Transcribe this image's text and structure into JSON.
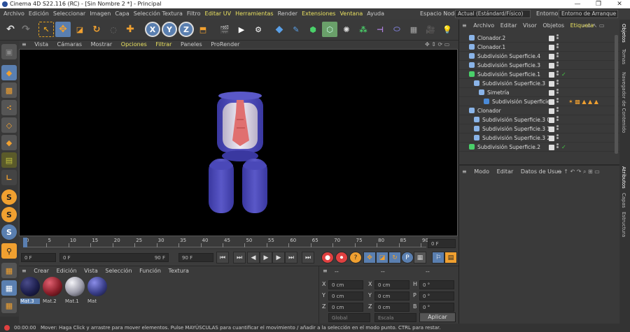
{
  "window": {
    "title": "Cinema 4D S22.116 (RC) - [Sin Nombre 2 *] - Principal",
    "minimize": "—",
    "restore": "❐",
    "close": "✕"
  },
  "menubar": {
    "items": [
      "Archivo",
      "Edición",
      "Seleccionar",
      "Imagen",
      "Capa",
      "Selección Textura",
      "Filtro",
      "Editar UV",
      "Herramientas",
      "Render",
      "Extensiones",
      "Ventana",
      "Ayuda"
    ],
    "node_space_label": "Espacio Nodo:",
    "node_space_value": "Actual (Estándard/Físico)",
    "layout_label": "Entorno:",
    "layout_value": "Entorno de Arranque"
  },
  "toolbar": {
    "x": "X",
    "y": "Y",
    "z": "Z"
  },
  "viewport": {
    "menu": [
      "Vista",
      "Cámaras",
      "Mostrar",
      "Opciones",
      "Filtrar",
      "Paneles",
      "ProRender"
    ]
  },
  "timeline": {
    "ticks": [
      "0",
      "5",
      "10",
      "15",
      "20",
      "25",
      "30",
      "35",
      "40",
      "45",
      "50",
      "55",
      "60",
      "65",
      "70",
      "75",
      "80",
      "85",
      "90"
    ],
    "current_frame": "0 F"
  },
  "transport": {
    "start": "0 F",
    "range_start": "0 F",
    "range_end": "90 F",
    "end": "90 F"
  },
  "materials": {
    "menu": [
      "Crear",
      "Edición",
      "Vista",
      "Selección",
      "Función",
      "Textura"
    ],
    "items": [
      {
        "name": "Mat.3",
        "color": "#1d1f4d"
      },
      {
        "name": "Mat.2",
        "color": "#8a1f2a"
      },
      {
        "name": "Mat.1",
        "color": "#9a9aa8"
      },
      {
        "name": "Mat",
        "color": "#3a3f8a"
      }
    ]
  },
  "coordinates": {
    "header_left": "--",
    "header_mid": "--",
    "header_right": "--",
    "rows": [
      {
        "a": "X",
        "av": "0 cm",
        "b": "X",
        "bv": "0 cm",
        "c": "H",
        "cv": "0 °"
      },
      {
        "a": "Y",
        "av": "0 cm",
        "b": "Y",
        "bv": "0 cm",
        "c": "P",
        "cv": "0 °"
      },
      {
        "a": "Z",
        "av": "0 cm",
        "b": "Z",
        "bv": "0 cm",
        "c": "B",
        "cv": "0 °"
      }
    ],
    "mode1": "Global",
    "mode2": "Escala",
    "apply": "Aplicar"
  },
  "objects": {
    "menu": [
      "Archivo",
      "Editar",
      "Visor",
      "Objetos",
      "Etiqueta"
    ],
    "rows": [
      {
        "name": "Clonador.2",
        "indent": 0,
        "icon": "#8ab4e8",
        "check": false
      },
      {
        "name": "Clonador.1",
        "indent": 0,
        "icon": "#8ab4e8",
        "check": false
      },
      {
        "name": "Subdivisión Superficie.4",
        "indent": 0,
        "icon": "#8ab4e8",
        "check": false
      },
      {
        "name": "Subdivisión Superficie.3",
        "indent": 0,
        "icon": "#8ab4e8",
        "check": false
      },
      {
        "name": "Subdivisión Superficie.1",
        "indent": 0,
        "icon": "#4ad06a",
        "check": true
      },
      {
        "name": "Subdivisión Superficie.3",
        "indent": 1,
        "icon": "#8ab4e8",
        "check": false
      },
      {
        "name": "Simetría",
        "indent": 2,
        "icon": "#8ab4e8",
        "check": false
      },
      {
        "name": "Subdivisión Superficie.1",
        "indent": 3,
        "icon": "#4a8ad8",
        "check": false
      },
      {
        "name": "Clonador",
        "indent": 0,
        "icon": "#8ab4e8",
        "check": false
      },
      {
        "name": "Subdivisión Superficie.3 0",
        "indent": 1,
        "icon": "#8ab4e8",
        "check": false
      },
      {
        "name": "Subdivisión Superficie.3 1",
        "indent": 1,
        "icon": "#8ab4e8",
        "check": false
      },
      {
        "name": "Subdivisión Superficie.3 2",
        "indent": 1,
        "icon": "#8ab4e8",
        "check": false
      },
      {
        "name": "Subdivisión Superficie.2",
        "indent": 0,
        "icon": "#4ad06a",
        "check": true
      }
    ]
  },
  "attributes": {
    "menu": [
      "Modo",
      "Editar",
      "Datos de Usua"
    ]
  },
  "right_tabs": [
    "Objetos",
    "Tomas",
    "Navegador de Contenido",
    "Atributos",
    "Capas",
    "Estructura"
  ],
  "status": {
    "time": "00:00:00",
    "message": "Mover: Haga Click y arrastre para mover elementos. Pulse MAYÚSCULAS para cuantificar el movimiento / añadir a la selección en el modo punto. CTRL para restar."
  }
}
